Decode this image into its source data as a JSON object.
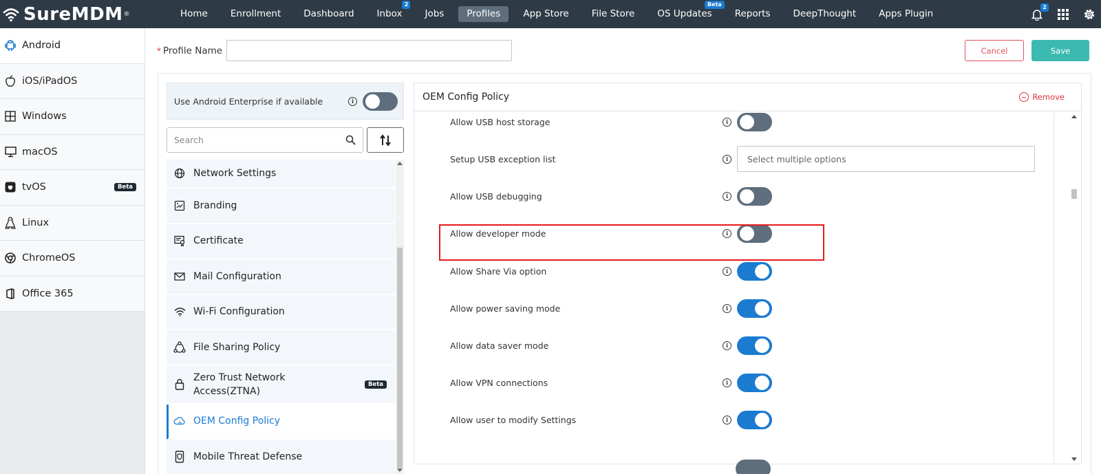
{
  "brand": {
    "name": "SureMDM",
    "reg": "®"
  },
  "nav": [
    {
      "label": "Home"
    },
    {
      "label": "Enrollment"
    },
    {
      "label": "Dashboard"
    },
    {
      "label": "Inbox",
      "badge": "2"
    },
    {
      "label": "Jobs"
    },
    {
      "label": "Profiles",
      "active": true
    },
    {
      "label": "App Store"
    },
    {
      "label": "File Store"
    },
    {
      "label": "OS Updates",
      "badge": "Beta"
    },
    {
      "label": "Reports"
    },
    {
      "label": "DeepThought"
    },
    {
      "label": "Apps Plugin"
    }
  ],
  "top_icons": {
    "notifications_icon": "bell-icon",
    "notifications_badge": "2",
    "apps_icon": "grid-icon",
    "settings_icon": "gear-icon"
  },
  "os_sidebar": [
    {
      "label": "Android",
      "icon": "android-icon",
      "active": true
    },
    {
      "label": "iOS/iPadOS",
      "icon": "apple-icon"
    },
    {
      "label": "Windows",
      "icon": "windows-icon"
    },
    {
      "label": "macOS",
      "icon": "monitor-icon"
    },
    {
      "label": "tvOS",
      "icon": "appletv-icon",
      "badge": "Beta"
    },
    {
      "label": "Linux",
      "icon": "linux-icon"
    },
    {
      "label": "ChromeOS",
      "icon": "chrome-icon"
    },
    {
      "label": "Office 365",
      "icon": "office-icon"
    }
  ],
  "profile": {
    "required_mark": "*",
    "label": "Profile Name",
    "value": "",
    "cancel_label": "Cancel",
    "save_label": "Save"
  },
  "android_enterprise": {
    "label": "Use Android Enterprise if available",
    "enabled": false
  },
  "search": {
    "placeholder": "Search"
  },
  "policies": [
    {
      "label": "Network Settings",
      "icon": "globe-icon"
    },
    {
      "label": "Branding",
      "icon": "branding-icon"
    },
    {
      "label": "Certificate",
      "icon": "certificate-icon"
    },
    {
      "label": "Mail Configuration",
      "icon": "mail-icon"
    },
    {
      "label": "Wi-Fi Configuration",
      "icon": "wifi-icon"
    },
    {
      "label": "File Sharing Policy",
      "icon": "share-icon"
    },
    {
      "label": "Zero Trust Network Access(ZTNA)",
      "icon": "lock-icon",
      "badge": "Beta"
    },
    {
      "label": "OEM Config Policy",
      "icon": "cloud-icon",
      "active": true
    },
    {
      "label": "Mobile Threat Defense",
      "icon": "phone-shield-icon"
    }
  ],
  "oem": {
    "title": "OEM Config Policy",
    "remove_label": "Remove",
    "settings": [
      {
        "label": "Allow USB host storage",
        "type": "toggle",
        "on": false
      },
      {
        "label": "Setup USB exception list",
        "type": "multiselect",
        "placeholder": "Select multiple options"
      },
      {
        "label": "Allow USB debugging",
        "type": "toggle",
        "on": false
      },
      {
        "label": "Allow developer mode",
        "type": "toggle",
        "on": false,
        "highlighted": true
      },
      {
        "label": "Allow Share Via option",
        "type": "toggle",
        "on": true
      },
      {
        "label": "Allow power saving mode",
        "type": "toggle",
        "on": true
      },
      {
        "label": "Allow data saver mode",
        "type": "toggle",
        "on": true
      },
      {
        "label": "Allow VPN connections",
        "type": "toggle",
        "on": true
      },
      {
        "label": "Allow user to modify Settings",
        "type": "toggle",
        "on": true
      }
    ]
  },
  "colors": {
    "topbar": "#2e3a45",
    "accent": "#1a7bd1",
    "toggle_off": "#5f6e7d",
    "save": "#3cbab1",
    "danger": "#e0323c",
    "highlight": "#e31b1b"
  }
}
